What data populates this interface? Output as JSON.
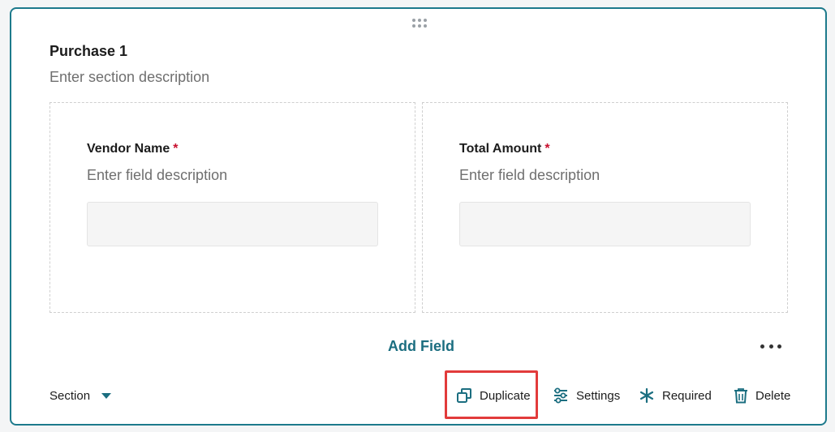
{
  "section": {
    "title": "Purchase 1",
    "description_placeholder": "Enter section description"
  },
  "fields": [
    {
      "label": "Vendor Name",
      "required_mark": "*",
      "description_placeholder": "Enter field description",
      "value": ""
    },
    {
      "label": "Total Amount",
      "required_mark": "*",
      "description_placeholder": "Enter field description",
      "value": ""
    }
  ],
  "add_field_label": "Add Field",
  "footer": {
    "section_dropdown_label": "Section",
    "duplicate_label": "Duplicate",
    "settings_label": "Settings",
    "required_label": "Required",
    "delete_label": "Delete"
  },
  "colors": {
    "accent": "#1b6e80",
    "border": "#1d7a8c",
    "required": "#c8102e",
    "highlight": "#e23b3b"
  },
  "icons": {
    "drag": "drag-handle-icon",
    "more": "more-horizontal-icon",
    "dropdown": "caret-down-icon",
    "duplicate": "duplicate-icon",
    "settings": "sliders-icon",
    "required": "asterisk-icon",
    "delete": "trash-icon"
  }
}
